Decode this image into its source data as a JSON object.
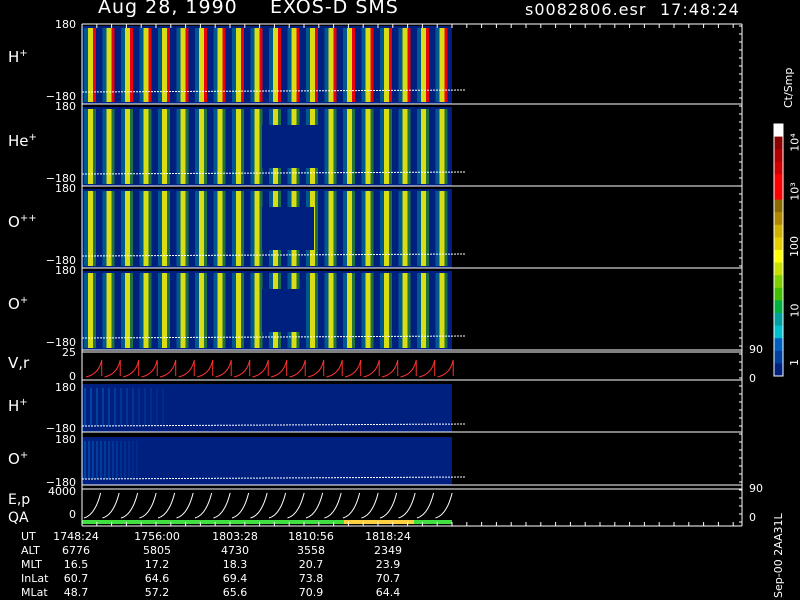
{
  "header": {
    "date": "Aug 28, 1990",
    "instrument": "EXOS-D SMS",
    "file": "s0082806.esr",
    "time": "17:48:24"
  },
  "panels": [
    {
      "id": "hplus",
      "species": "H",
      "charge": "+",
      "top_tick": "180",
      "bottom_tick": "−180"
    },
    {
      "id": "heplus",
      "species": "He",
      "charge": "+",
      "top_tick": "180",
      "bottom_tick": "−180"
    },
    {
      "id": "opp",
      "species": "O",
      "charge": "++",
      "top_tick": "180",
      "bottom_tick": "−180"
    },
    {
      "id": "oplus",
      "species": "O",
      "charge": "+",
      "top_tick": "180",
      "bottom_tick": "−180"
    }
  ],
  "vr_panel": {
    "label": "V,r",
    "top_tick": "25",
    "bottom_tick": "0",
    "right_top": "90",
    "right_bottom": "0"
  },
  "low_panels": [
    {
      "id": "hplus2",
      "species": "H",
      "charge": "+",
      "top_tick": "180",
      "bottom_tick": "−180"
    },
    {
      "id": "oplus2",
      "species": "O",
      "charge": "+",
      "top_tick": "180",
      "bottom_tick": "−180"
    }
  ],
  "ep_panel": {
    "label1": "E,p",
    "label2": "QA",
    "top_tick": "4000",
    "bottom_tick": "0",
    "right_top": "90",
    "right_bottom": "0"
  },
  "colorbar": {
    "unit": "Ct/Smp",
    "ticks": [
      "10⁴",
      "10³",
      "100",
      "10",
      "1"
    ],
    "colors": [
      "#ffffff",
      "#8b0000",
      "#b00000",
      "#d00000",
      "#ff0000",
      "#ff0000",
      "#8b6b00",
      "#b08800",
      "#d0b000",
      "#e8d000",
      "#ffff00",
      "#c8e000",
      "#80d000",
      "#40c000",
      "#00b040",
      "#00a0a0",
      "#00c0d0",
      "#0060c0",
      "#0040a0",
      "#002080"
    ]
  },
  "table": {
    "rows": [
      {
        "label": "UT",
        "values": [
          "1748:24",
          "1756:00",
          "1803:28",
          "1810:56",
          "1818:24"
        ]
      },
      {
        "label": "ALT",
        "values": [
          "6776",
          "5805",
          "4730",
          "3558",
          "2349"
        ]
      },
      {
        "label": "MLT",
        "values": [
          "16.5",
          "17.2",
          "18.3",
          "20.7",
          "23.9"
        ]
      },
      {
        "label": "InLat",
        "values": [
          "60.7",
          "64.6",
          "69.4",
          "73.8",
          "70.7"
        ]
      },
      {
        "label": "MLat",
        "values": [
          "48.7",
          "57.2",
          "65.6",
          "70.9",
          "64.4"
        ]
      }
    ]
  },
  "footer_vertical": "Sep-00  2AA31L",
  "chart_data": {
    "type": "heatmap",
    "title": "Aug 28, 1990   EXOS-D SMS",
    "x": [
      "1748:24",
      "1756:00",
      "1803:28",
      "1810:56",
      "1818:24"
    ],
    "ion_panels": [
      "H+",
      "He+",
      "O++",
      "O+"
    ],
    "ylim": [
      -180,
      180
    ],
    "vr_ylim": [
      0,
      25
    ],
    "ep_ylim": [
      0,
      4000
    ],
    "colorbar_unit": "Ct/Smp",
    "colorbar_ticks": [
      1,
      10,
      100,
      1000,
      10000
    ],
    "spin_periods_visible": 20,
    "colors": {
      "low": "#002080",
      "mid": "#ffff00",
      "high": "#ff0000",
      "trace_vr": "#ff3030"
    }
  }
}
